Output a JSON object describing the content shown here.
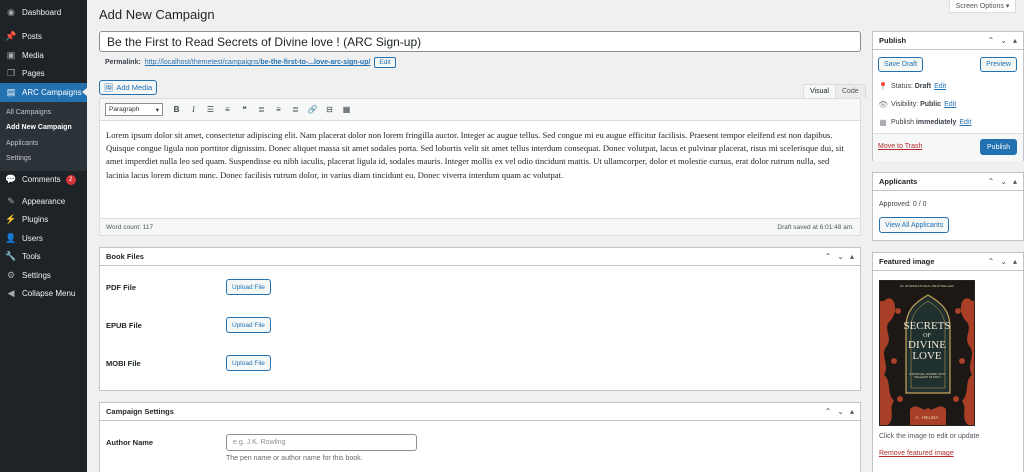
{
  "sidebar": {
    "items": [
      {
        "label": "Dashboard",
        "icon": "dashboard-icon"
      },
      {
        "label": "Posts",
        "icon": "pin-icon"
      },
      {
        "label": "Media",
        "icon": "media-icon"
      },
      {
        "label": "Pages",
        "icon": "pages-icon"
      },
      {
        "label": "ARC Campaigns",
        "icon": "campaign-icon"
      },
      {
        "label": "Comments",
        "icon": "comments-icon",
        "badge": "2"
      },
      {
        "label": "Appearance",
        "icon": "brush-icon"
      },
      {
        "label": "Plugins",
        "icon": "plugin-icon"
      },
      {
        "label": "Users",
        "icon": "users-icon"
      },
      {
        "label": "Tools",
        "icon": "tools-icon"
      },
      {
        "label": "Settings",
        "icon": "settings-icon"
      },
      {
        "label": "Collapse Menu",
        "icon": "collapse-icon"
      }
    ],
    "submenu": [
      "All Campaigns",
      "Add New Campaign",
      "Applicants",
      "Settings"
    ]
  },
  "screen_options": "Screen Options ▾",
  "page_title": "Add New Campaign",
  "title_value": "Be the First to Read Secrets of Divine love ! (ARC Sign-up)",
  "permalink": {
    "label": "Permalink:",
    "base": "http://localhost/themetest/campaigns/",
    "slug": "be-the-first-to-...love-arc-sign-up/",
    "edit": "Edit"
  },
  "editor": {
    "add_media": "Add Media",
    "tab_visual": "Visual",
    "tab_code": "Code",
    "format": "Paragraph",
    "body": "Lorem ipsum dolor sit amet, consectetur adipiscing elit. Nam placerat dolor non lorem fringilla auctor. Integer ac augue tellus. Sed congue mi eu augue efficitur facilisis. Praesent tempor eleifend est non dapibus. Quisque congue ligula non porttitor dignissim. Donec aliquet massa sit amet sodales porta. Sed lobortis velit sit amet tellus interdum consequat. Donec volutpat, lacus et pulvinar placerat, risus mi scelerisque dui, sit amet imperdiet nulla leo sed quam. Suspendisse eu nibh iaculis, placerat ligula id, sodales mauris. Integer mollis ex vel odio tincidunt mattis. Ut ullamcorper, dolor et molestie cursus, erat dolor rutrum nulla, sed lacinia lacus lorem dictum nunc. Donec facilisis rutrum dolor, in varius diam tincidunt eu. Donec viverra interdum quam ac volutpat.",
    "word_count": "Word count: 117",
    "draft_saved": "Draft saved at 6:01:48 am."
  },
  "book_files": {
    "title": "Book Files",
    "rows": [
      {
        "label": "PDF File",
        "button": "Upload File"
      },
      {
        "label": "EPUB File",
        "button": "Upload File"
      },
      {
        "label": "MOBI File",
        "button": "Upload File"
      }
    ]
  },
  "campaign_settings": {
    "title": "Campaign Settings",
    "author_label": "Author Name",
    "author_placeholder": "e.g. J.K. Rowling",
    "author_help": "The pen name or author name for this book."
  },
  "publish": {
    "title": "Publish",
    "save_draft": "Save Draft",
    "preview": "Preview",
    "status_label": "Status:",
    "status_value": "Draft",
    "visibility_label": "Visibility:",
    "visibility_value": "Public",
    "publish_label": "Publish",
    "publish_value": "immediately",
    "edit": "Edit",
    "trash": "Move to Trash",
    "publish_button": "Publish"
  },
  "applicants": {
    "title": "Applicants",
    "approved": "Approved: 0 / 0",
    "view_all": "View All Applicants"
  },
  "featured": {
    "title": "Featured image",
    "cover_top": "#1 INTERNATIONAL BESTSELLER",
    "cover_line1": "SECRETS",
    "cover_line2": "OF",
    "cover_line3": "DIVINE",
    "cover_line4": "LOVE",
    "cover_subtitle": "A SPIRITUAL JOURNEY INTO THE HEART OF FAITH",
    "cover_author": "A. HELWA",
    "hint": "Click the image to edit or update",
    "remove": "Remove featured image"
  }
}
